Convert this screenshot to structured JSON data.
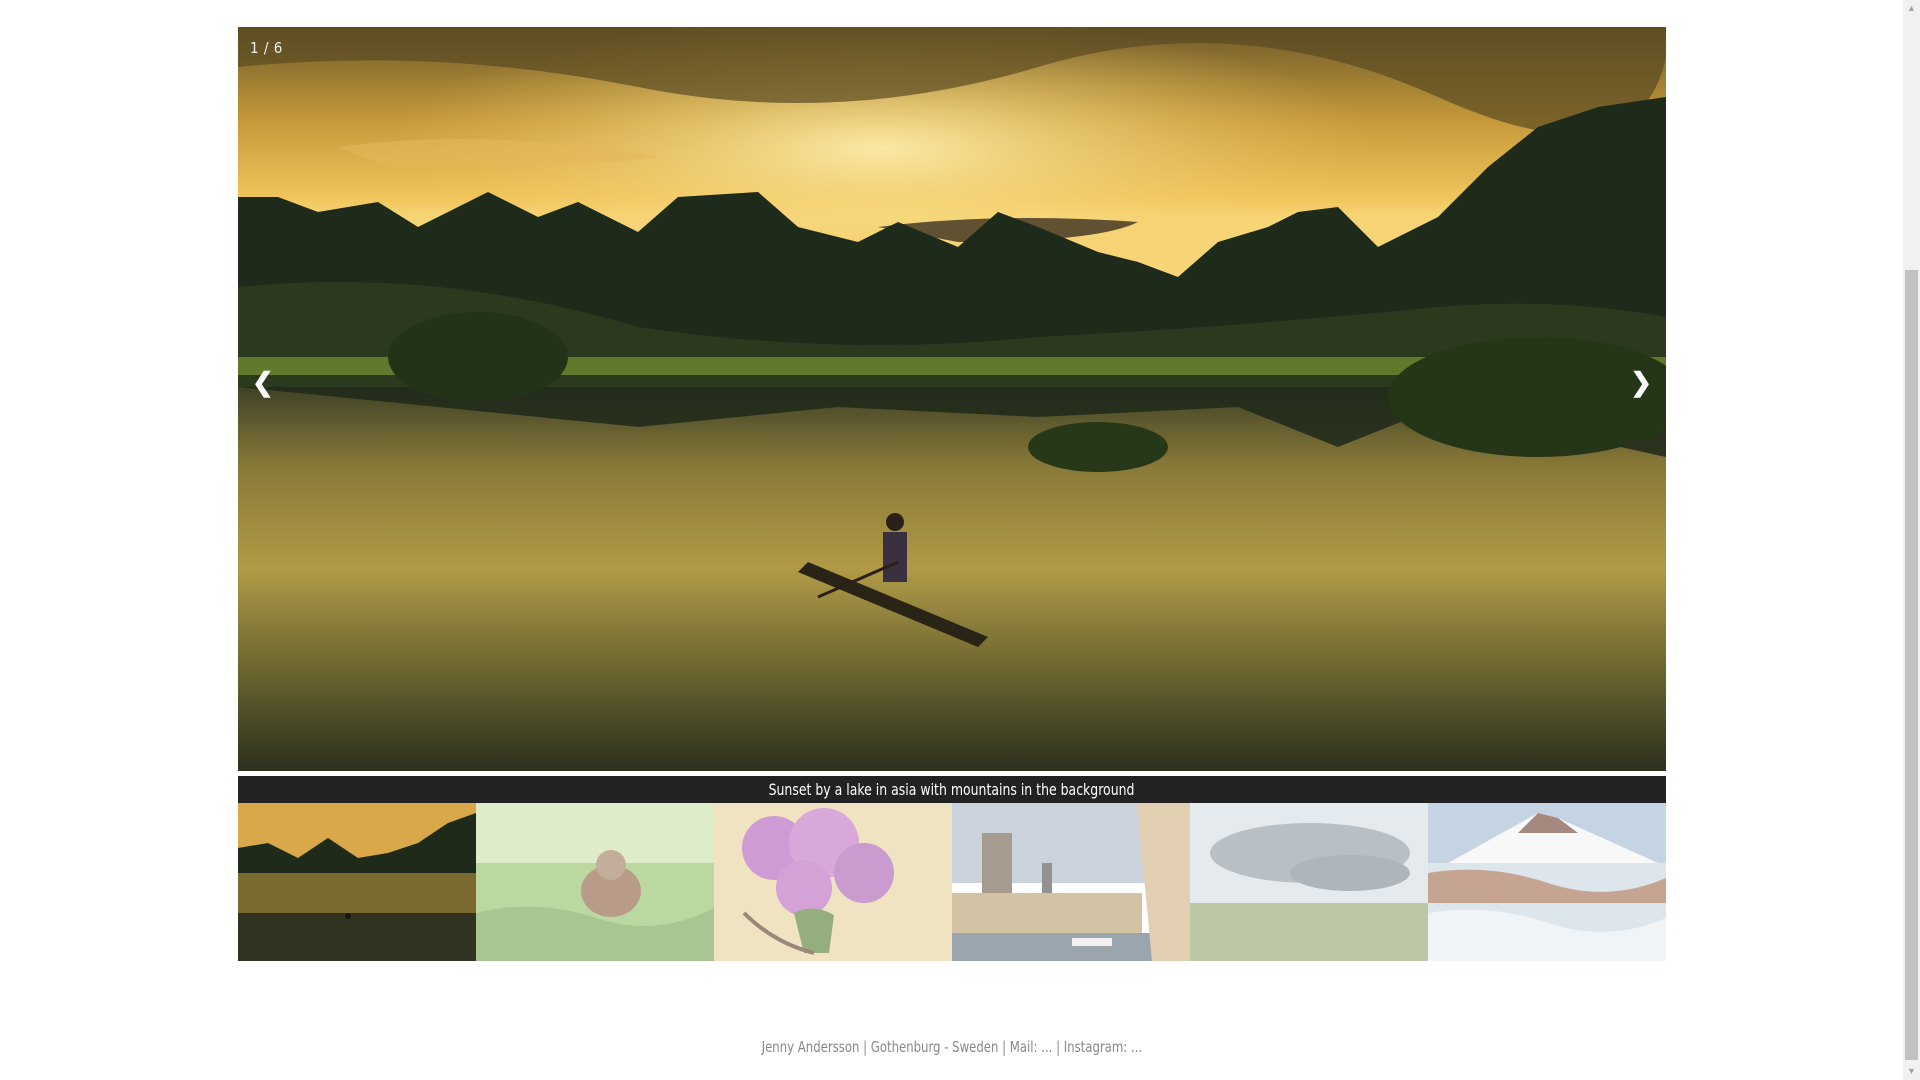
{
  "slideshow": {
    "counter": "1 / 6",
    "prev_label": "❮",
    "next_label": "❯",
    "caption": "Sunset by a lake in asia with mountains in the background",
    "active_index": 1,
    "total": 6
  },
  "thumbnails": [
    {
      "name": "thumb-sunset-lake",
      "active": true
    },
    {
      "name": "thumb-bird-grass",
      "active": false
    },
    {
      "name": "thumb-lilac-flowers",
      "active": false
    },
    {
      "name": "thumb-city-harbor",
      "active": false
    },
    {
      "name": "thumb-storm-field",
      "active": false
    },
    {
      "name": "thumb-snowy-mountain",
      "active": false
    }
  ],
  "footer": {
    "text": "Jenny Andersson | Gothenburg - Sweden | Mail: ... | Instagram: ..."
  },
  "colors": {
    "caption_bg": "#222222",
    "footer_text": "#888888"
  }
}
